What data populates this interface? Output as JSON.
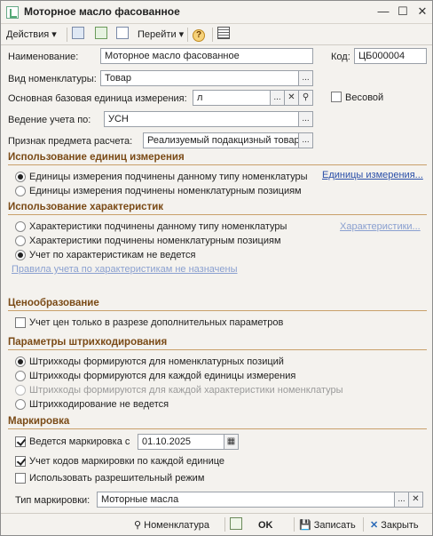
{
  "window": {
    "title": "Моторное масло фасованное"
  },
  "toolbar": {
    "actions": "Действия",
    "goto": "Перейти"
  },
  "fields": {
    "name_label": "Наименование:",
    "name_value": "Моторное масло фасованное",
    "code_label": "Код:",
    "code_value": "ЦБ000004",
    "type_label": "Вид номенклатуры:",
    "type_value": "Товар",
    "unit_label": "Основная базовая единица измерения:",
    "unit_value": "л",
    "weight_label": "Весовой",
    "acc_label": "Ведение учета по:",
    "acc_value": "УСН",
    "sign_label": "Признак предмета расчета:",
    "sign_value": "Реализуемый подакцизный товар"
  },
  "units_section": {
    "title": "Использование единиц измерения",
    "opt1": "Единицы измерения подчинены данному типу номенклатуры",
    "opt2": "Единицы измерения подчинены номенклатурным позициям",
    "link": "Единицы измерения..."
  },
  "chars_section": {
    "title": "Использование характеристик",
    "opt1": "Характеристики подчинены данному типу номенклатуры",
    "opt2": "Характеристики подчинены номенклатурным позициям",
    "opt3": "Учет по характеристикам не ведется",
    "link": "Характеристики...",
    "rules_link": "Правила учета по характеристикам не назначены"
  },
  "pricing_section": {
    "title": "Ценообразование",
    "cb1": "Учет цен только в разрезе дополнительных параметров"
  },
  "barcode_section": {
    "title": "Параметры штрихкодирования",
    "opt1": "Штрихкоды формируются для номенклатурных позиций",
    "opt2": "Штрихкоды формируются для каждой единицы измерения",
    "opt3": "Штрихкоды формируются для каждой характеристики номенклатуры",
    "opt4": "Штрихкодирование не ведется"
  },
  "marking_section": {
    "title": "Маркировка",
    "cb1": "Ведется маркировка с",
    "date": "01.10.2025",
    "cb2": "Учет кодов маркировки по каждой единице",
    "cb3": "Использовать разрешительный режим",
    "type_label": "Тип маркировки:",
    "type_value": "Моторные масла"
  },
  "bottom": {
    "nomenclature": "Номенклатура",
    "ok": "OK",
    "save": "Записать",
    "close": "Закрыть"
  }
}
